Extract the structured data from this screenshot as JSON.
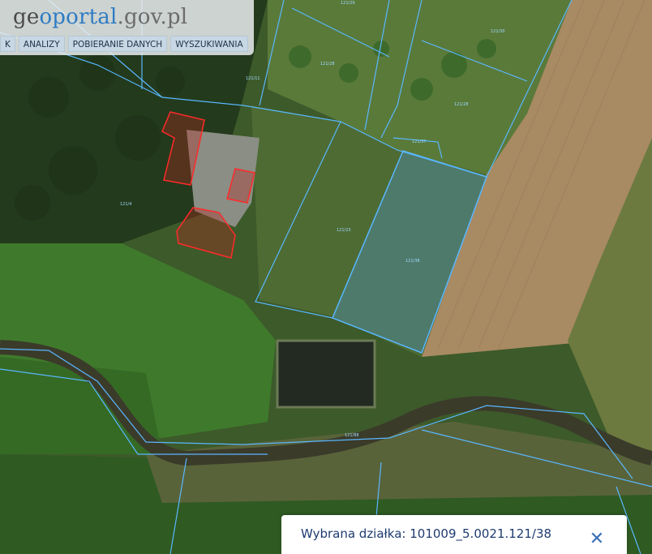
{
  "logo": {
    "part1": "ge",
    "part2": "oportal",
    "part3": ".gov.pl"
  },
  "menu": {
    "items": [
      {
        "label": "K"
      },
      {
        "label": "ANALIZY"
      },
      {
        "label": "POBIERANIE DANYCH"
      },
      {
        "label": "WYSZUKIWANIA"
      }
    ]
  },
  "selection": {
    "text": "Wybrana działka: 101009_5.0021.121/38",
    "close_icon": "close-icon"
  },
  "colors": {
    "parcel_line": "#59b7ff",
    "building_outline": "#ff2a2a",
    "selected_parcel_fill": "#4f8fb0",
    "field_brown": "#8f7552",
    "grass_green": "#3f6b2c"
  }
}
